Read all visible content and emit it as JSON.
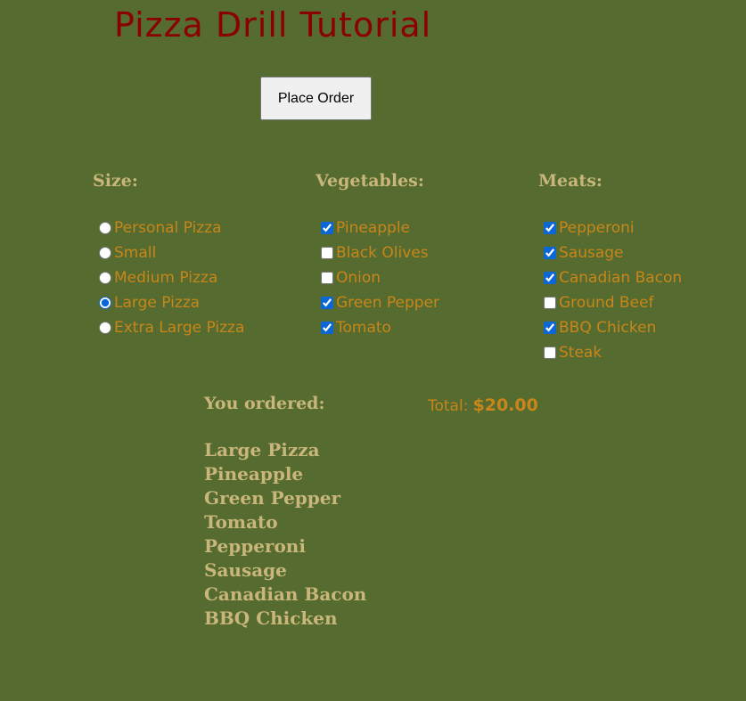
{
  "title": "Pizza Drill Tutorial",
  "place_order_label": "Place Order",
  "size": {
    "heading": "Size:",
    "options": [
      {
        "label": "Personal Pizza",
        "checked": false
      },
      {
        "label": "Small",
        "checked": false
      },
      {
        "label": "Medium Pizza",
        "checked": false
      },
      {
        "label": "Large Pizza",
        "checked": true
      },
      {
        "label": "Extra Large Pizza",
        "checked": false
      }
    ]
  },
  "vegetables": {
    "heading": "Vegetables:",
    "options": [
      {
        "label": "Pineapple",
        "checked": true
      },
      {
        "label": "Black Olives",
        "checked": false
      },
      {
        "label": "Onion",
        "checked": false
      },
      {
        "label": "Green Pepper",
        "checked": true
      },
      {
        "label": "Tomato",
        "checked": true
      }
    ]
  },
  "meats": {
    "heading": "Meats:",
    "options": [
      {
        "label": "Pepperoni",
        "checked": true
      },
      {
        "label": "Sausage",
        "checked": true
      },
      {
        "label": "Canadian Bacon",
        "checked": true
      },
      {
        "label": "Ground Beef",
        "checked": false
      },
      {
        "label": "BBQ Chicken",
        "checked": true
      },
      {
        "label": "Steak",
        "checked": false
      }
    ]
  },
  "summary": {
    "heading": "You ordered:",
    "total_label": "Total:",
    "total_value": "$20.00",
    "items": [
      "Large Pizza",
      "Pineapple",
      "Green Pepper",
      "Tomato",
      "Pepperoni",
      "Sausage",
      "Canadian Bacon",
      "BBQ Chicken"
    ]
  },
  "colors": {
    "background": "#556b2f",
    "title": "#8b0000",
    "heading": "#c8b67a",
    "option_text": "#c8861a"
  }
}
